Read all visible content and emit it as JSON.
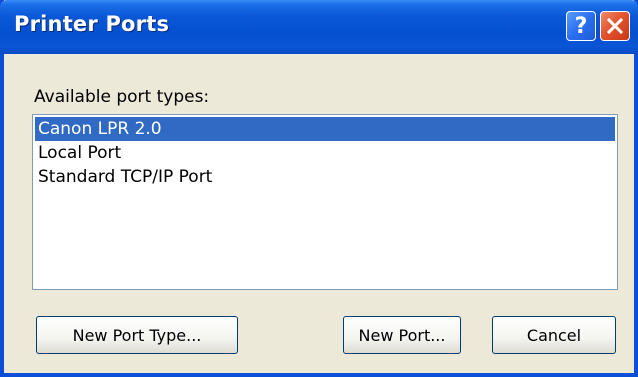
{
  "window": {
    "title": "Printer Ports",
    "help_glyph": "?",
    "close_icon": "close-icon"
  },
  "main": {
    "available_label": "Available port types:",
    "port_types": [
      {
        "label": "Canon LPR 2.0",
        "selected": true
      },
      {
        "label": "Local Port",
        "selected": false
      },
      {
        "label": "Standard TCP/IP Port",
        "selected": false
      }
    ]
  },
  "buttons": {
    "new_port_type": "New Port Type...",
    "new_port": "New Port...",
    "cancel": "Cancel"
  },
  "colors": {
    "titlebar": "#0450d0",
    "selection": "#316ac5",
    "close_button": "#e0502a",
    "dialog_background": "#ece9d8"
  }
}
